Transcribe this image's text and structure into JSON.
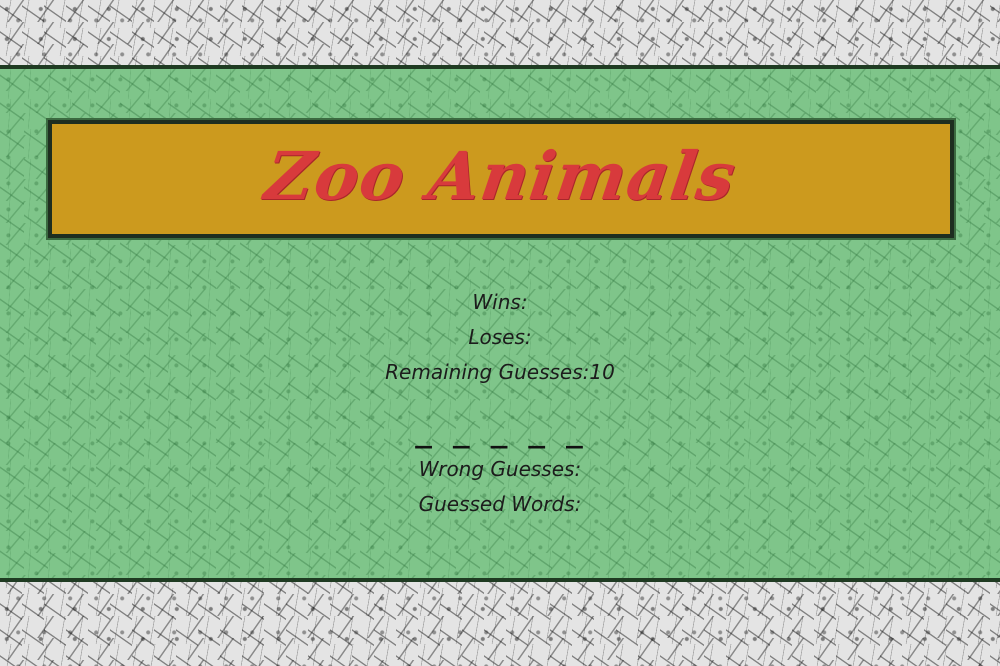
{
  "game": {
    "title": "Zoo Animals"
  },
  "stats": {
    "wins_label": "Wins:",
    "wins_value": "",
    "loses_label": "Loses:",
    "loses_value": "",
    "remaining_label": "Remaining Guesses:",
    "remaining_value": "10"
  },
  "word": {
    "blanks": "_ _ _ _ _"
  },
  "history": {
    "wrong_label": "Wrong Guesses:",
    "wrong_value": "",
    "guessed_label": "Guessed Words:",
    "guessed_value": ""
  },
  "colors": {
    "page_background": "#e4e4e4",
    "panel_green": "#7fc58a",
    "banner_gold": "#cc9a1e",
    "title_red": "#d83a3c",
    "border_dark": "#1f3b22"
  }
}
